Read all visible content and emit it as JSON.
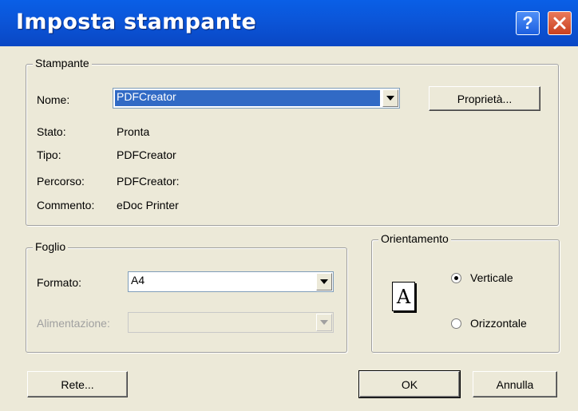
{
  "window": {
    "title": "Imposta stampante",
    "help_glyph": "?",
    "close_icon": "close-icon"
  },
  "printer": {
    "legend": "Stampante",
    "name_label": "Nome:",
    "name_value": "PDFCreator",
    "properties_button": "Proprietà...",
    "status_label": "Stato:",
    "status_value": "Pronta",
    "type_label": "Tipo:",
    "type_value": "PDFCreator",
    "path_label": "Percorso:",
    "path_value": "PDFCreator:",
    "comment_label": "Commento:",
    "comment_value": "eDoc Printer"
  },
  "paper": {
    "legend": "Foglio",
    "size_label": "Formato:",
    "size_value": "A4",
    "source_label": "Alimentazione:",
    "source_value": ""
  },
  "orientation": {
    "legend": "Orientamento",
    "icon_letter": "A",
    "portrait_label": "Verticale",
    "landscape_label": "Orizzontale",
    "selected": "Verticale"
  },
  "buttons": {
    "network": "Rete...",
    "ok": "OK",
    "cancel": "Annulla"
  }
}
